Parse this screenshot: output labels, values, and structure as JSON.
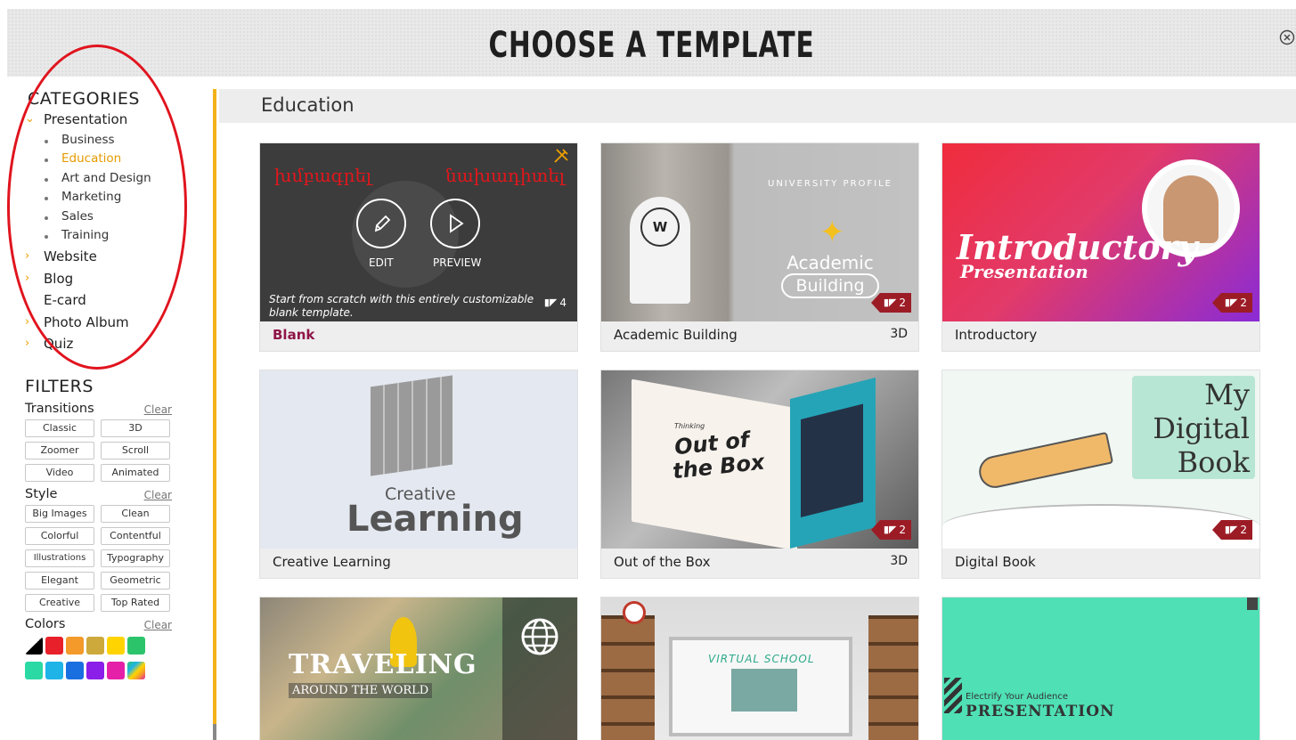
{
  "header": {
    "title": "CHOOSE A TEMPLATE",
    "close_icon": "close-circle-icon"
  },
  "sidebar": {
    "categories_title": "CATEGORIES",
    "categories": [
      {
        "label": "Presentation",
        "expanded": true
      },
      {
        "label": "Website"
      },
      {
        "label": "Blog"
      },
      {
        "label": "E-card"
      },
      {
        "label": "Photo Album"
      },
      {
        "label": "Quiz"
      }
    ],
    "subcategories": [
      "Business",
      "Education",
      "Art and Design",
      "Marketing",
      "Sales",
      "Training"
    ],
    "active_subcategory": "Education",
    "filters_title": "FILTERS",
    "transitions": {
      "label": "Transitions",
      "clear": "Clear",
      "options": [
        "Classic",
        "3D",
        "Zoomer",
        "Scroll",
        "Video",
        "Animated"
      ]
    },
    "style": {
      "label": "Style",
      "clear": "Clear",
      "options": [
        "Big Images",
        "Clean",
        "Colorful",
        "Contentful",
        "Illustrations",
        "Typography",
        "Elegant",
        "Geometric",
        "Creative",
        "Top Rated"
      ]
    },
    "colors": {
      "label": "Colors",
      "clear": "Clear",
      "swatches": [
        "#000000",
        "#e8202a",
        "#f39a2b",
        "#cda93b",
        "#ffd400",
        "#2bc46b",
        "#2bd9a5",
        "#1eb4e8",
        "#1a6fe0",
        "#8b1ee8",
        "#e61fa8",
        "rainbow"
      ]
    }
  },
  "main": {
    "section_title": "Education",
    "templates": [
      {
        "name": "Blank",
        "description": "Start from scratch with this entirely customizable blank template.",
        "edit_label": "EDIT",
        "preview_label": "PREVIEW",
        "overlay_left": "խմբագրել",
        "overlay_right": "նախադիտել",
        "slides": "4"
      },
      {
        "name": "Academic Building",
        "badge": "3D",
        "slides": "2",
        "thumb_line1": "UNIVERSITY PROFILE",
        "thumb_line2": "Academic",
        "thumb_line3": "Building"
      },
      {
        "name": "Introductory",
        "slides": "2",
        "thumb_line1": "Introductory",
        "thumb_line2": "Presentation"
      },
      {
        "name": "Creative Learning",
        "thumb_line1": "Creative",
        "thumb_line2": "Learning"
      },
      {
        "name": "Out of the Box",
        "badge": "3D",
        "slides": "2",
        "thumb_line1": "Thinking",
        "thumb_line2": "Out of",
        "thumb_line3": "the Box"
      },
      {
        "name": "Digital Book",
        "slides": "2",
        "thumb_line1": "My",
        "thumb_line2": "Digital",
        "thumb_line3": "Book"
      },
      {
        "name": "Traveling",
        "thumb_line1": "TRAVELING",
        "thumb_line2": "AROUND THE WORLD"
      },
      {
        "name": "Virtual School",
        "thumb_line1": "VIRTUAL SCHOOL"
      },
      {
        "name": "Presentation",
        "thumb_line1": "Electrify Your Audience",
        "thumb_line2": "PRESENTATION"
      }
    ]
  }
}
